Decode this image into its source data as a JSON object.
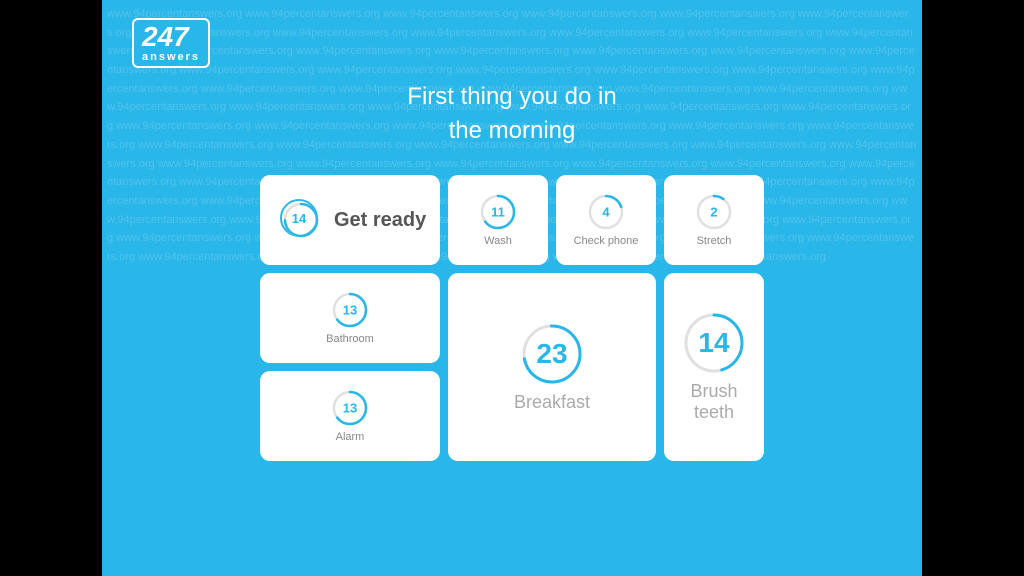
{
  "logo": {
    "number": "247",
    "text": "answers"
  },
  "question": "First thing you do in\nthe morning",
  "watermark_text": "www.94percentanswers.org www.94percentanswers.org www.94percentanswers.org www.94percentanswers.org www.94percentanswers.org www.94percentanswers.org",
  "cards": [
    {
      "id": "get-ready",
      "number": "14",
      "label": "Get ready",
      "large_number": false,
      "size": "wide"
    },
    {
      "id": "wash",
      "number": "11",
      "label": "Wash",
      "large_number": false,
      "size": "small"
    },
    {
      "id": "check-phone",
      "number": "4",
      "label": "Check phone",
      "large_number": false,
      "size": "small"
    },
    {
      "id": "stretch",
      "number": "2",
      "label": "Stretch",
      "large_number": false,
      "size": "small"
    },
    {
      "id": "bathroom",
      "number": "13",
      "label": "Bathroom",
      "large_number": false,
      "size": "small"
    },
    {
      "id": "breakfast",
      "number": "23",
      "label": "Breakfast",
      "large_number": true,
      "size": "large"
    },
    {
      "id": "alarm",
      "number": "13",
      "label": "Alarm",
      "large_number": false,
      "size": "small"
    },
    {
      "id": "brush-teeth",
      "number": "14",
      "label": "Brush teeth",
      "large_number": true,
      "size": "large"
    }
  ]
}
